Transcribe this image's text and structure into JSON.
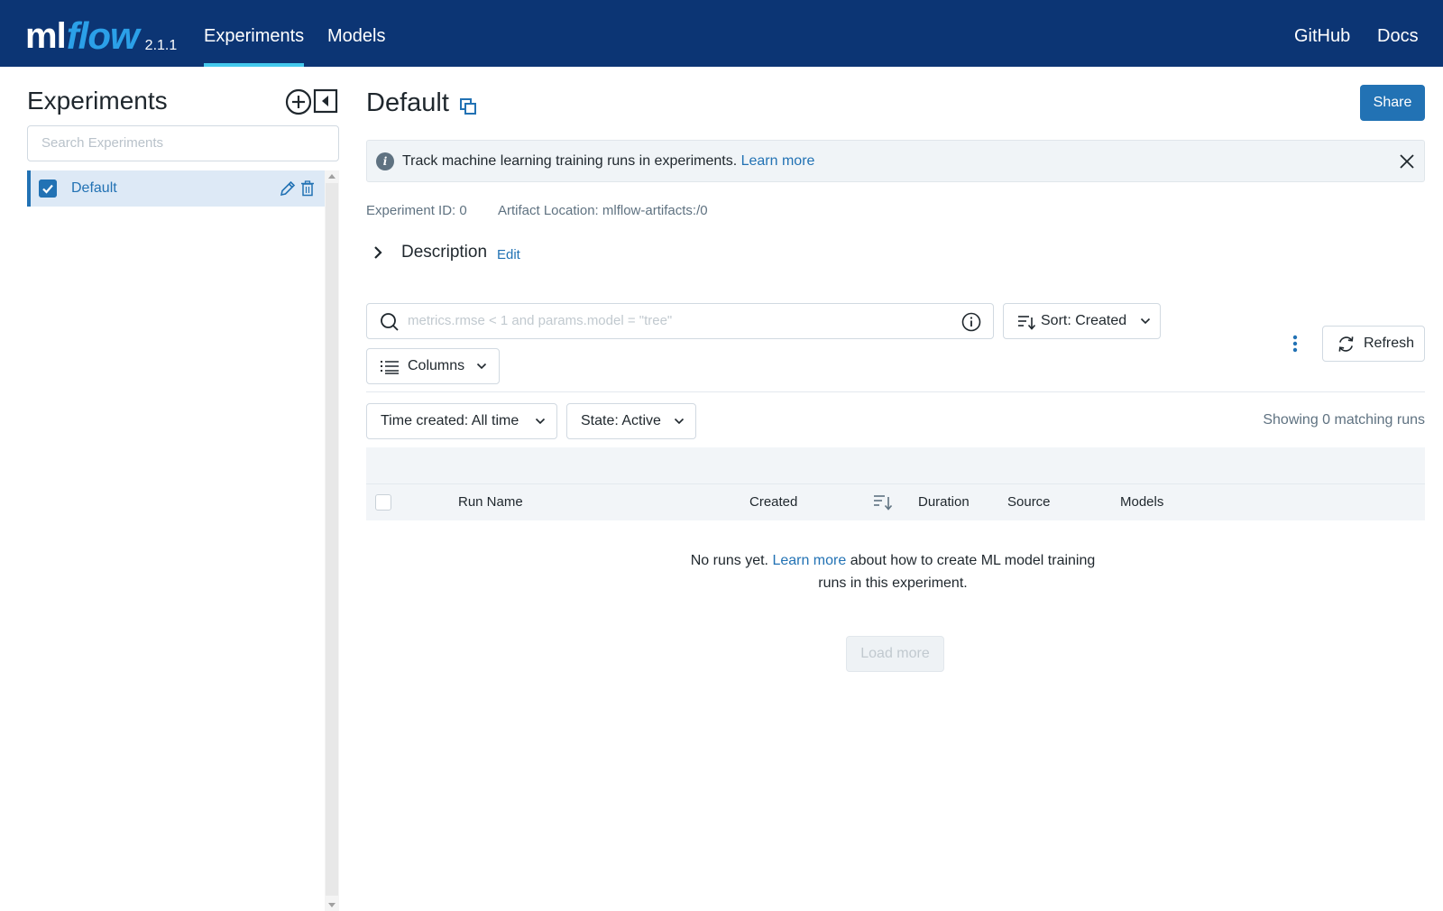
{
  "header": {
    "logo_ml": "ml",
    "logo_flow": "flow",
    "version": "2.1.1",
    "nav": [
      {
        "label": "Experiments",
        "active": true
      },
      {
        "label": "Models",
        "active": false
      }
    ],
    "right_links": [
      {
        "label": "GitHub"
      },
      {
        "label": "Docs"
      }
    ],
    "colors": {
      "bar": "#0c3574",
      "accent": "#43c9ed",
      "logo_accent": "#2ba0e8"
    }
  },
  "sidebar": {
    "title": "Experiments",
    "search_placeholder": "Search Experiments",
    "items": [
      {
        "label": "Default",
        "checked": true,
        "selected": true
      }
    ],
    "icons": [
      "plus-circle-icon",
      "collapse-sidebar-icon",
      "pencil-icon",
      "trash-icon"
    ]
  },
  "main": {
    "title": "Default",
    "share_label": "Share",
    "banner": {
      "text": "Track machine learning training runs in experiments.",
      "link": "Learn more"
    },
    "experiment_id": "Experiment ID: 0",
    "artifact_location": "Artifact Location: mlflow-artifacts:/0",
    "description_label": "Description",
    "description_edit": "Edit",
    "search_placeholder": "metrics.rmse < 1 and params.model = \"tree\"",
    "sort_label": "Sort: Created",
    "columns_label": "Columns",
    "refresh_label": "Refresh",
    "time_filter_label": "Time created: All time",
    "state_filter_label": "State: Active",
    "showing_text": "Showing 0 matching runs",
    "table_headers": [
      "Run Name",
      "Created",
      "Duration",
      "Source",
      "Models"
    ],
    "empty": {
      "prefix": "No runs yet.",
      "link": "Learn more",
      "suffix": "about how to create ML model training",
      "line2": "runs in this experiment."
    },
    "load_more_label": "Load more",
    "colors": {
      "primary": "#2272b4"
    }
  }
}
